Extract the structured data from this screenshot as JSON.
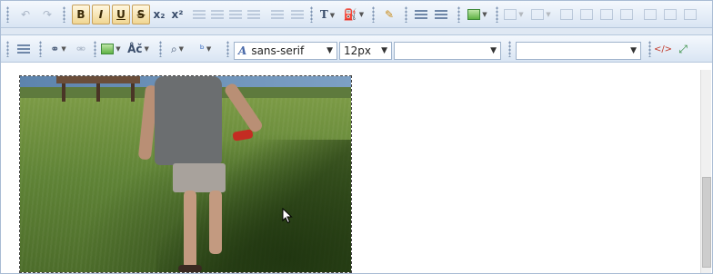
{
  "toolbar1": {
    "bold_label": "B",
    "italic_label": "I",
    "underline_label": "U",
    "strike_label": "S",
    "subscript_label": "x₂",
    "superscript_label": "x²",
    "text_color_label": "T"
  },
  "toolbar2": {
    "spellcheck_label": "Åč",
    "font_family": {
      "value": "sans-serif"
    },
    "font_size": {
      "value": "12px"
    },
    "format_select": {
      "value": ""
    },
    "style_select": {
      "value": ""
    }
  },
  "colors": {
    "toolbar_top": "#f4f8fd",
    "toolbar_bottom": "#d9e5f3",
    "border": "#a9bcd4",
    "active_button": "#f0d692"
  },
  "icons": [
    "undo-icon",
    "redo-icon",
    "align-left-icon",
    "align-center-icon",
    "align-right-icon",
    "align-justify-icon",
    "outdent-icon",
    "indent-icon",
    "fill-color-icon",
    "highlighter-icon",
    "bullet-list-icon",
    "numbered-list-icon",
    "image-icon",
    "table-icon",
    "link-icon",
    "unlink-icon",
    "find-replace-icon",
    "source-code-icon",
    "fullscreen-icon"
  ]
}
